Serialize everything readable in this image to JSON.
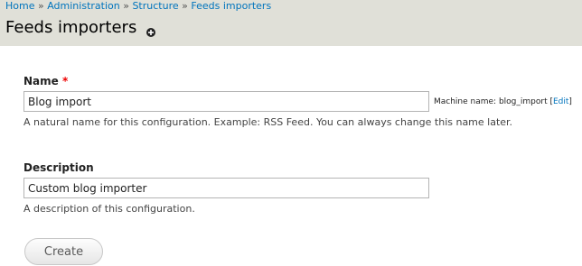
{
  "header": {
    "breadcrumb": [
      {
        "label": "Home"
      },
      {
        "label": "Administration"
      },
      {
        "label": "Structure"
      },
      {
        "label": "Feeds importers"
      }
    ],
    "separator": "»",
    "title": "Feeds importers",
    "shortcut_icon": "add-shortcut-icon"
  },
  "form": {
    "name": {
      "label": "Name",
      "required_marker": "*",
      "value": "Blog import",
      "machine_name_prefix": "Machine name: blog_import",
      "edit_link": "Edit",
      "description": "A natural name for this configuration. Example: RSS Feed. You can always change this name later."
    },
    "description": {
      "label": "Description",
      "value": "Custom blog importer",
      "description": "A description of this configuration."
    },
    "submit_label": "Create"
  }
}
